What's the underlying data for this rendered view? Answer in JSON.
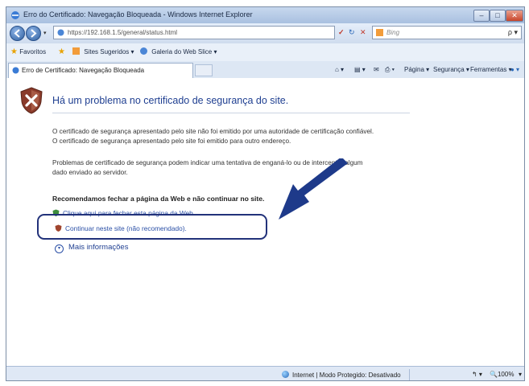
{
  "window": {
    "title": "Erro do Certificado: Navegação Bloqueada - Windows Internet Explorer",
    "controls": {
      "minimize": "–",
      "maximize": "□",
      "close": "✕"
    }
  },
  "address_bar": {
    "url": "https://192.168.1.5/general/status.html",
    "dropdown": "▾",
    "cert_error": "✓",
    "refresh": "↻",
    "stop": "✕",
    "search_placeholder": "Bing",
    "search_button": "ρ ▾"
  },
  "favorites_bar": {
    "favorites_label": "Favoritos",
    "items": [
      "Sites Sugeridos ▾",
      "Galeria do Web Slice ▾"
    ]
  },
  "tabs": [
    {
      "label": "Erro de Certificado: Navegação Bloqueada"
    }
  ],
  "command_bar": {
    "home": "⌂ ▾",
    "feeds": "▤ ▾",
    "mail": "✉",
    "print": "⎙ ▾",
    "page": "Página ▾",
    "safety": "Segurança ▾",
    "tools": "Ferramentas ▾",
    "help": "● ▾"
  },
  "content": {
    "headline": "Há um problema no certificado de segurança do site.",
    "paragraph1": [
      "O certificado de segurança apresentado pelo site não foi emitido por uma autoridade de certificação confiável.",
      "O certificado de segurança apresentado pelo site foi emitido para outro endereço."
    ],
    "paragraph2": [
      "Problemas de certificado de segurança podem indicar uma tentativa de enganá-lo ou de interceptar algum",
      "dado enviado ao servidor."
    ],
    "recommendation": "Recomendamos fechar a página da Web e não continuar no site.",
    "option_close": "Clique aqui para fechar esta página da Web.",
    "option_continue": "Continuar neste site (não recomendado).",
    "more_info": "Mais informações",
    "more_info_icon": "chevron-down-icon"
  },
  "status_bar": {
    "zone": "Internet | Modo Protegido: Desativado",
    "zone_dropdown": "↰ ▾",
    "zoom": "100%",
    "zoom_icon": "🔍",
    "zoom_dropdown": "▾"
  },
  "colors": {
    "headline": "#1f3f91",
    "link": "#2a4fa6",
    "highlight": "#22327a",
    "arrow": "#1e3a8a",
    "shield": "#8a3a2a"
  }
}
